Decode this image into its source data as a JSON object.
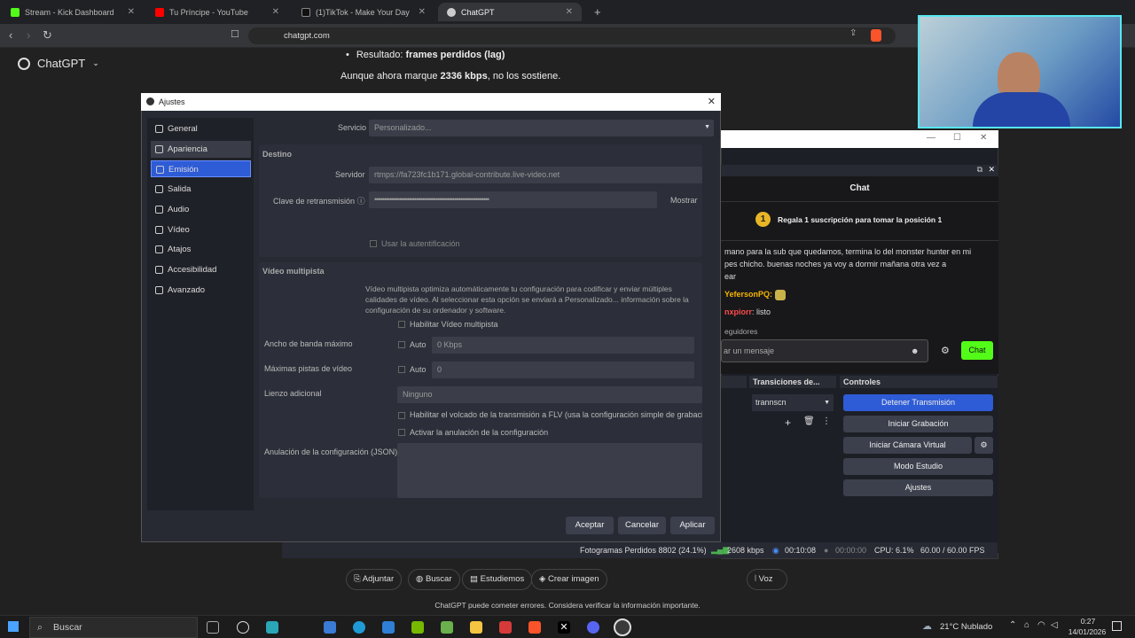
{
  "browser": {
    "tabs": [
      {
        "label": "Stream - Kick Dashboard",
        "color": "#53fc18"
      },
      {
        "label": "Tu Príncipe - YouTube",
        "color": "#ff0000"
      },
      {
        "label": "(1)TikTok - Make Your Day",
        "color": "#111111"
      },
      {
        "label": "ChatGPT",
        "color": "#cccccc"
      }
    ],
    "new_tab": "+",
    "url": "chatgpt.com"
  },
  "chatgpt": {
    "brand": "ChatGPT",
    "result_prefix": "Resultado: ",
    "result_bold": "frames perdidos (lag)",
    "line2_prefix": "Aunque ahora marque ",
    "line2_bold": "2336 kbps",
    "line2_suffix": ", no los sostiene.",
    "composer": {
      "attach": "Adjuntar",
      "search": "Buscar",
      "study": "Estudiemos",
      "image": "Crear imagen",
      "voice": "Voz"
    },
    "disclaimer": "ChatGPT puede cometer errores. Considera verificar la información importante."
  },
  "dialog": {
    "title": "Ajustes",
    "sidebar": [
      {
        "label": "General",
        "icon": "gear-icon"
      },
      {
        "label": "Apariencia",
        "icon": "palette-icon"
      },
      {
        "label": "Emisión",
        "icon": "broadcast-icon"
      },
      {
        "label": "Salida",
        "icon": "output-icon"
      },
      {
        "label": "Audio",
        "icon": "speaker-icon"
      },
      {
        "label": "Vídeo",
        "icon": "monitor-icon"
      },
      {
        "label": "Atajos",
        "icon": "keyboard-icon"
      },
      {
        "label": "Accesibilidad",
        "icon": "accessibility-icon"
      },
      {
        "label": "Avanzado",
        "icon": "tools-icon"
      }
    ],
    "service_label": "Servicio",
    "service_value": "Personalizado...",
    "destino": "Destino",
    "server_label": "Servidor",
    "server_value": "rtmps://fa723fc1b171.global-contribute.live-video.net",
    "key_label": "Clave de retransmisión",
    "key_value": "••••••••••••••••••••••••••••••••••••••••••••••••••••••••••••",
    "show_btn": "Mostrar",
    "auth_label": "Usar la autentificación",
    "multitrack_title": "Vídeo multipista",
    "multitrack_desc": "Vídeo multipista optimiza automáticamente tu configuración para codificar y enviar múltiples calidades de vídeo. Al seleccionar esta opción se enviará a Personalizado... información sobre la configuración de su ordenador y software.",
    "enable_multitrack": "Habilitar Vídeo multipista",
    "bandwidth_label": "Ancho de banda máximo",
    "bandwidth_auto": "Auto",
    "bandwidth_value": "0 Kbps",
    "tracks_label": "Máximas pistas de vídeo",
    "tracks_auto": "Auto",
    "tracks_value": "0",
    "canvas_label": "Lienzo adicional",
    "canvas_value": "Ninguno",
    "flv_label": "Habilitar el volcado de la transmisión a FLV (usa la configuración simple de grabació",
    "override_label": "Activar la anulación de la configuración",
    "json_label": "Anulación de la configuración (JSON)",
    "buttons": {
      "accept": "Aceptar",
      "cancel": "Cancelar",
      "apply": "Aplicar"
    }
  },
  "obs": {
    "chat_title": "Chat",
    "sub_text": "Regala 1 suscripción para tomar la posición 1",
    "sub_rank": "1",
    "messages": [
      "mano para la sub que quedamos, termina lo del monster hunter en mi",
      "pes chicho. buenas noches ya voy a dormir mañana otra vez a",
      "ear"
    ],
    "user1": "YefersonPQ:",
    "user2": "nxpiorr",
    "user2_msg": ": listo",
    "followers": "eguidores",
    "chat_placeholder": "ar un mensaje",
    "chat_btn": "Chat",
    "transitions_title": "Transiciones de...",
    "transition_value": "trannscn",
    "controls_title": "Controles",
    "controls": [
      "Detener Transmisión",
      "Iniciar Grabación",
      "Iniciar Cámara Virtual",
      "Modo Estudio",
      "Ajustes"
    ],
    "status": {
      "dropped": "Fotogramas Perdidos 8802 (24.1%)",
      "kbps": "2608 kbps",
      "stream_time": "00:10:08",
      "rec_time": "00:00:00",
      "cpu": "CPU: 6.1%",
      "fps": "60.00 / 60.00 FPS"
    }
  },
  "taskbar": {
    "search": "Buscar",
    "weather": "21°C  Nublado",
    "time": "0:27",
    "date": "14/01/2026"
  }
}
